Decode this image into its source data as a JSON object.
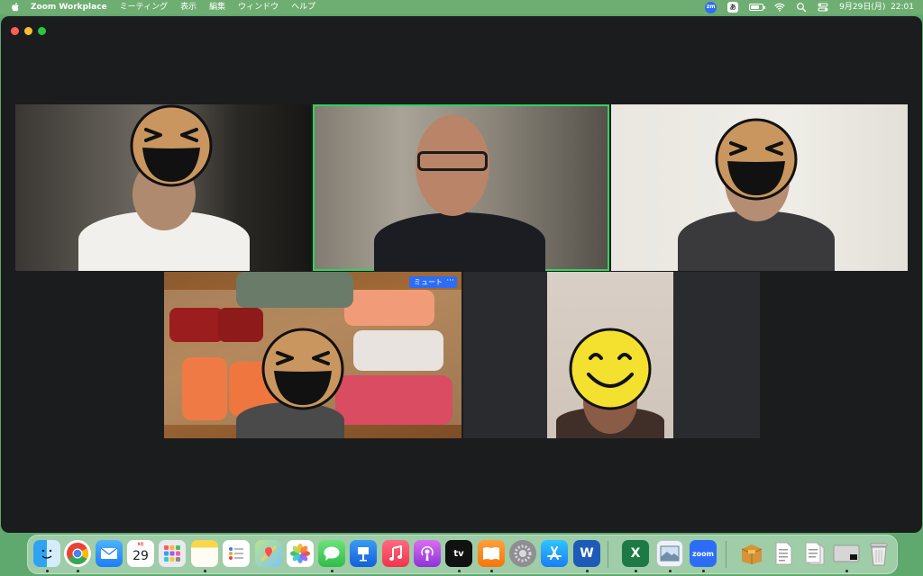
{
  "menubar": {
    "app_name": "Zoom Workplace",
    "items": [
      "ミーティング",
      "表示",
      "編集",
      "ウィンドウ",
      "ヘルプ"
    ],
    "zoom_badge": "zm",
    "input_badge": "あ",
    "datetime": "9月29日(月)  22:01"
  },
  "meeting": {
    "tiles": [
      {
        "name": "participant-1",
        "face": "laughing-emoji"
      },
      {
        "name": "participant-2-active-speaker",
        "face": "none"
      },
      {
        "name": "participant-3",
        "face": "laughing-emoji"
      },
      {
        "name": "participant-4",
        "face": "laughing-emoji"
      },
      {
        "name": "participant-5",
        "face": "smiling-emoji"
      }
    ],
    "hover_controls": {
      "mute_label": "ミュート",
      "more_label": "···"
    }
  },
  "dock": {
    "calendar_month": "9月",
    "calendar_day": "29",
    "apps": [
      "finder-icon",
      "chrome-icon",
      "mail-icon",
      "calendar-icon",
      "launchpad-icon",
      "notes-icon",
      "reminders-icon",
      "maps-icon",
      "photos-icon",
      "messages-icon",
      "keynote-icon",
      "music-icon",
      "podcasts-icon",
      "tv-icon",
      "books-icon",
      "settings-icon",
      "appstore-icon",
      "word-icon",
      "excel-icon",
      "preview-icon",
      "zoom-icon",
      "archive-icon",
      "document-icon",
      "document2-icon",
      "screen-icon",
      "trash-icon"
    ],
    "tv_label": "tv",
    "zoom_label": "zoom",
    "word_label": "W",
    "excel_label": "X"
  }
}
